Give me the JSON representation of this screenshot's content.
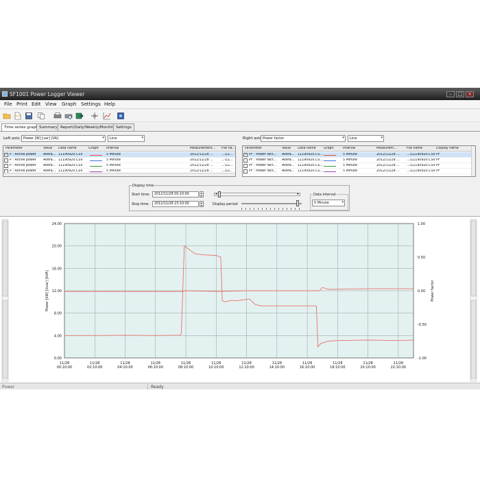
{
  "window": {
    "title": "SF1001 Power Logger Viewer"
  },
  "menu": [
    "File",
    "Print",
    "Edit",
    "View",
    "Graph",
    "Settings",
    "Help"
  ],
  "toolbar_icons": [
    "open-folder-icon",
    "open-file-icon",
    "save-icon",
    "copy-icon",
    "print-icon",
    "print-preview-icon",
    "export-icon",
    "cursor-icon",
    "graph-settings-icon",
    "help-icon"
  ],
  "tabs": [
    "Time series graph",
    "Summary",
    "Report(Daily/Weekly/Monthly)",
    "Settings"
  ],
  "left_axis": {
    "label": "Left axis:",
    "quantity": "Power [W] [var] [VA]",
    "graph_type": "Line",
    "columns": [
      "Parameter",
      "Value",
      "Data name",
      "Graph",
      "Interval",
      "Measurement...",
      "File na..."
    ],
    "rows": [
      {
        "checked": true,
        "parameter": "P : Active power",
        "value": "Avera...",
        "data_name": "11190920.CSV",
        "color": "#e74c3c",
        "interval": "5 Minute",
        "measurement": "2012/11/28 ...",
        "file": "...\\11..."
      },
      {
        "checked": false,
        "parameter": "P : Active power",
        "value": "Avera...",
        "data_name": "11190920.CSV",
        "color": "#3a6fd8",
        "interval": "5 Minute",
        "measurement": "2012/11/28 ...",
        "file": "...\\11..."
      },
      {
        "checked": false,
        "parameter": "P : Active power",
        "value": "Avera...",
        "data_name": "11190920.CSV",
        "color": "#2e9e3e",
        "interval": "5 Minute",
        "measurement": "2012/11/28 ...",
        "file": "...\\11..."
      },
      {
        "checked": false,
        "parameter": "P : Active power",
        "value": "Avera...",
        "data_name": "11190920.CSV",
        "color": "#8e44ad",
        "interval": "5 Minute",
        "measurement": "2012/11/28 ...",
        "file": "...\\11..."
      }
    ]
  },
  "right_axis": {
    "label": "Right axis:",
    "quantity": "Power factor",
    "graph_type": "Line",
    "columns": [
      "Parameter",
      "Value",
      "Data name",
      "Graph",
      "Interval",
      "Measurem...",
      "File name",
      "Display name"
    ],
    "rows": [
      {
        "checked": true,
        "parameter": "PF : Power fact...",
        "value": "Avera...",
        "data_name": "11190920.CS...",
        "color": "#e74c3c",
        "interval": "5 Minute",
        "measurement": "2012/11/28 ...",
        "file": "...\\11190920.CSV",
        "display": "PF"
      },
      {
        "checked": false,
        "parameter": "PF : Power fact...",
        "value": "Avera...",
        "data_name": "11190920.CS...",
        "color": "#3a6fd8",
        "interval": "5 Minute",
        "measurement": "2012/11/28 ...",
        "file": "...\\11190920.CSV",
        "display": "PF"
      },
      {
        "checked": false,
        "parameter": "PF : Power fact...",
        "value": "Avera...",
        "data_name": "11190920.CS...",
        "color": "#2e9e3e",
        "interval": "5 Minute",
        "measurement": "2012/11/28 ...",
        "file": "...\\11190920.CSV",
        "display": "PF"
      },
      {
        "checked": false,
        "parameter": "PF : Power fact...",
        "value": "Avera...",
        "data_name": "11190920.CS...",
        "color": "#8e44ad",
        "interval": "5 Minute",
        "measurement": "2012/11/28 ...",
        "file": "...\\11190920.CSV",
        "display": "PF"
      }
    ]
  },
  "display_time": {
    "title": "Display time",
    "start_label": "Start time:",
    "start_value": "2012/11/28 00:10:00",
    "stop_label": "Stop time:",
    "stop_value": "2012/11/28 23:10:00",
    "period_label": "Display period:",
    "interval_title": "Data interval",
    "interval_value": "5 Minute",
    "start_slider_fraction": 0.0,
    "period_slider_fraction": 0.95
  },
  "status": {
    "left": "Power",
    "message": "Ready"
  },
  "colors": {
    "plot_bg": "#e3f1f1",
    "series": "#e8736a",
    "grid": "#9a9a9a"
  },
  "chart_data": {
    "type": "line",
    "xlabel": "",
    "ylabel": "Power [kW] [kvar] [kVA]",
    "y2label": "Power factor",
    "ylim": [
      0,
      24
    ],
    "y2lim": [
      -1,
      1
    ],
    "y_ticks": [
      "0.00",
      "4.00",
      "8.00",
      "12.00",
      "16.00",
      "20.00",
      "24.00"
    ],
    "y2_ticks": [
      "-1.00",
      "-0.50",
      "0.00",
      "0.50",
      "1.00"
    ],
    "x_ticks": [
      {
        "date": "11/28",
        "time": "00:10:00"
      },
      {
        "date": "11/28",
        "time": "02:10:00"
      },
      {
        "date": "11/28",
        "time": "04:10:00"
      },
      {
        "date": "11/28",
        "time": "06:10:00"
      },
      {
        "date": "11/28",
        "time": "08:10:00"
      },
      {
        "date": "11/28",
        "time": "10:10:00"
      },
      {
        "date": "11/28",
        "time": "12:10:00"
      },
      {
        "date": "11/28",
        "time": "14:10:00"
      },
      {
        "date": "11/28",
        "time": "16:10:00"
      },
      {
        "date": "11/28",
        "time": "18:10:00"
      },
      {
        "date": "11/28",
        "time": "20:10:00"
      },
      {
        "date": "11/28",
        "time": "22:10:00"
      }
    ],
    "xlim_hours": [
      0,
      23
    ],
    "series": [
      {
        "axis": "left",
        "points": [
          [
            0,
            4.0
          ],
          [
            2,
            4.0
          ],
          [
            4,
            4.05
          ],
          [
            6,
            4.0
          ],
          [
            7.6,
            4.05
          ],
          [
            7.7,
            4.3
          ],
          [
            7.9,
            20.0
          ],
          [
            8.2,
            19.4
          ],
          [
            8.6,
            18.6
          ],
          [
            9.2,
            18.4
          ],
          [
            10,
            18.3
          ],
          [
            10.3,
            18.0
          ],
          [
            10.4,
            10.2
          ],
          [
            10.6,
            10.0
          ],
          [
            11,
            10.3
          ],
          [
            11.4,
            10.2
          ],
          [
            11.8,
            10.4
          ],
          [
            12.2,
            10.5
          ],
          [
            12.6,
            9.5
          ],
          [
            13,
            9.3
          ],
          [
            14,
            9.3
          ],
          [
            16,
            9.3
          ],
          [
            16.6,
            9.3
          ],
          [
            16.7,
            2.0
          ],
          [
            16.9,
            2.6
          ],
          [
            17.4,
            3.0
          ],
          [
            18,
            3.1
          ],
          [
            20,
            3.2
          ],
          [
            22,
            3.1
          ],
          [
            23,
            3.2
          ]
        ]
      },
      {
        "axis": "right",
        "points": [
          [
            0,
            -0.01
          ],
          [
            4,
            -0.01
          ],
          [
            7.8,
            -0.01
          ],
          [
            8,
            0.0
          ],
          [
            10,
            -0.01
          ],
          [
            12,
            0.0
          ],
          [
            14,
            0.0
          ],
          [
            16.8,
            0.0
          ],
          [
            17,
            0.05
          ],
          [
            17.4,
            0.02
          ],
          [
            20,
            0.03
          ],
          [
            23,
            0.03
          ]
        ]
      }
    ]
  }
}
